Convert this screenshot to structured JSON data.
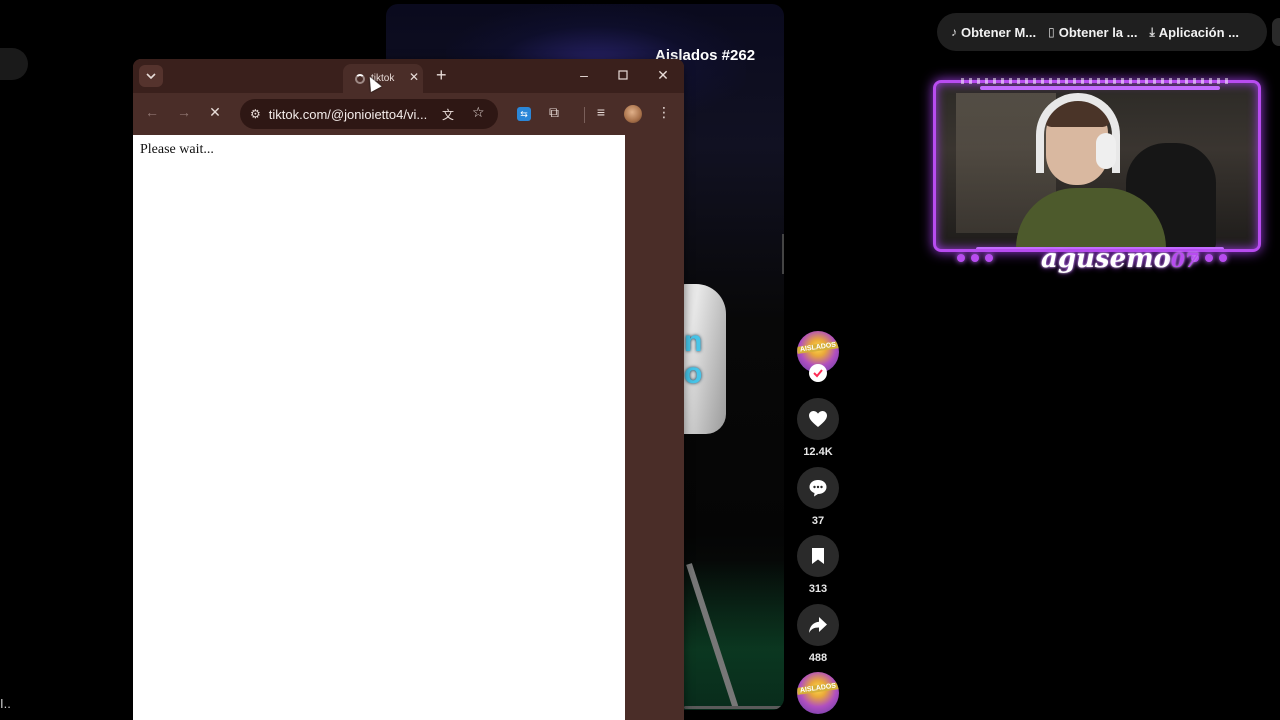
{
  "background_page": {
    "video_title": "Aislados #262",
    "video_caption_fragment": "n\no",
    "bottom_left_text": "I..",
    "actions": {
      "likes": "12.4K",
      "comments": "37",
      "saves": "313",
      "shares": "488"
    },
    "avatar_text": "AISLADOS",
    "top_menu": [
      {
        "icon": "tiktok-icon",
        "label": "Obtener M..."
      },
      {
        "icon": "phone-icon",
        "label": "Obtener la ..."
      },
      {
        "icon": "download-icon",
        "label": "Aplicación ..."
      }
    ]
  },
  "webcam_overlay": {
    "name": "agusemo",
    "name_suffix": "07",
    "accent_color": "#b84cf0"
  },
  "browser_popup": {
    "tab_title": "tiktok",
    "url": "tiktok.com/@jonioietto4/vi...",
    "page_text": "Please wait...",
    "theme_color": "#4a2d28"
  }
}
